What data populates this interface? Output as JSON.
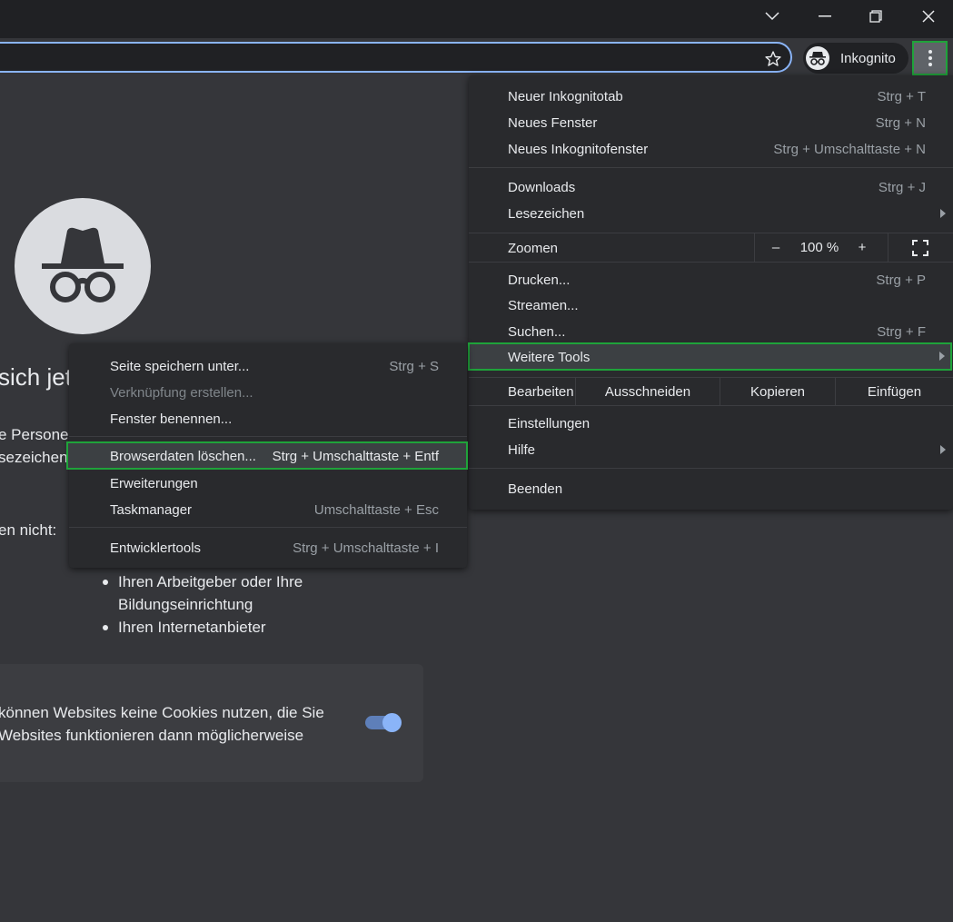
{
  "window": {
    "controls": [
      "chevron-down",
      "minimize",
      "restore",
      "close"
    ]
  },
  "toolbar": {
    "profile_label": "Inkognito"
  },
  "page": {
    "heading": "sich jet",
    "para_line1": "e Persone",
    "para_line2": "sezeichen",
    "para_line3": "en nicht:",
    "bullets": [
      "Ihren Arbeitgeber oder Ihre",
      "Bildungseinrichtung",
      "Ihren Internetanbieter"
    ],
    "cookie_line1": "können Websites keine Cookies nutzen, die Sie",
    "cookie_line2": "Websites funktionieren dann möglicherweise",
    "cookie_toggle_on": true
  },
  "menu": {
    "group1": [
      {
        "label": "Neuer Inkognitotab",
        "shortcut": "Strg + T"
      },
      {
        "label": "Neues Fenster",
        "shortcut": "Strg + N"
      },
      {
        "label": "Neues Inkognitofenster",
        "shortcut": "Strg + Umschalttaste + N"
      }
    ],
    "group2": [
      {
        "label": "Downloads",
        "shortcut": "Strg + J"
      },
      {
        "label": "Lesezeichen",
        "shortcut": ""
      }
    ],
    "zoom": {
      "label": "Zoomen",
      "minus": "–",
      "value": "100 %",
      "plus": "+"
    },
    "group3": [
      {
        "label": "Drucken...",
        "shortcut": "Strg + P"
      },
      {
        "label": "Streamen...",
        "shortcut": ""
      },
      {
        "label": "Suchen...",
        "shortcut": "Strg + F"
      },
      {
        "label": "Weitere Tools",
        "shortcut": ""
      }
    ],
    "edit": {
      "label": "Bearbeiten",
      "cut": "Ausschneiden",
      "copy": "Kopieren",
      "paste": "Einfügen"
    },
    "group4": [
      {
        "label": "Einstellungen",
        "shortcut": ""
      },
      {
        "label": "Hilfe",
        "shortcut": ""
      }
    ],
    "exit": "Beenden"
  },
  "submenu": {
    "items": [
      {
        "label": "Seite speichern unter...",
        "shortcut": "Strg + S"
      },
      {
        "label": "Verknüpfung erstellen...",
        "shortcut": ""
      },
      {
        "label": "Fenster benennen...",
        "shortcut": ""
      },
      {
        "label": "Browserdaten löschen...",
        "shortcut": "Strg + Umschalttaste + Entf"
      },
      {
        "label": "Erweiterungen",
        "shortcut": ""
      },
      {
        "label": "Taskmanager",
        "shortcut": "Umschalttaste + Esc"
      },
      {
        "label": "Entwicklertools",
        "shortcut": "Strg + Umschalttaste + I"
      }
    ]
  },
  "colors": {
    "accent": "#8ab4f8",
    "highlight_border": "#1fa33a",
    "menu_bg": "#292a2d",
    "page_bg": "#35363a"
  }
}
